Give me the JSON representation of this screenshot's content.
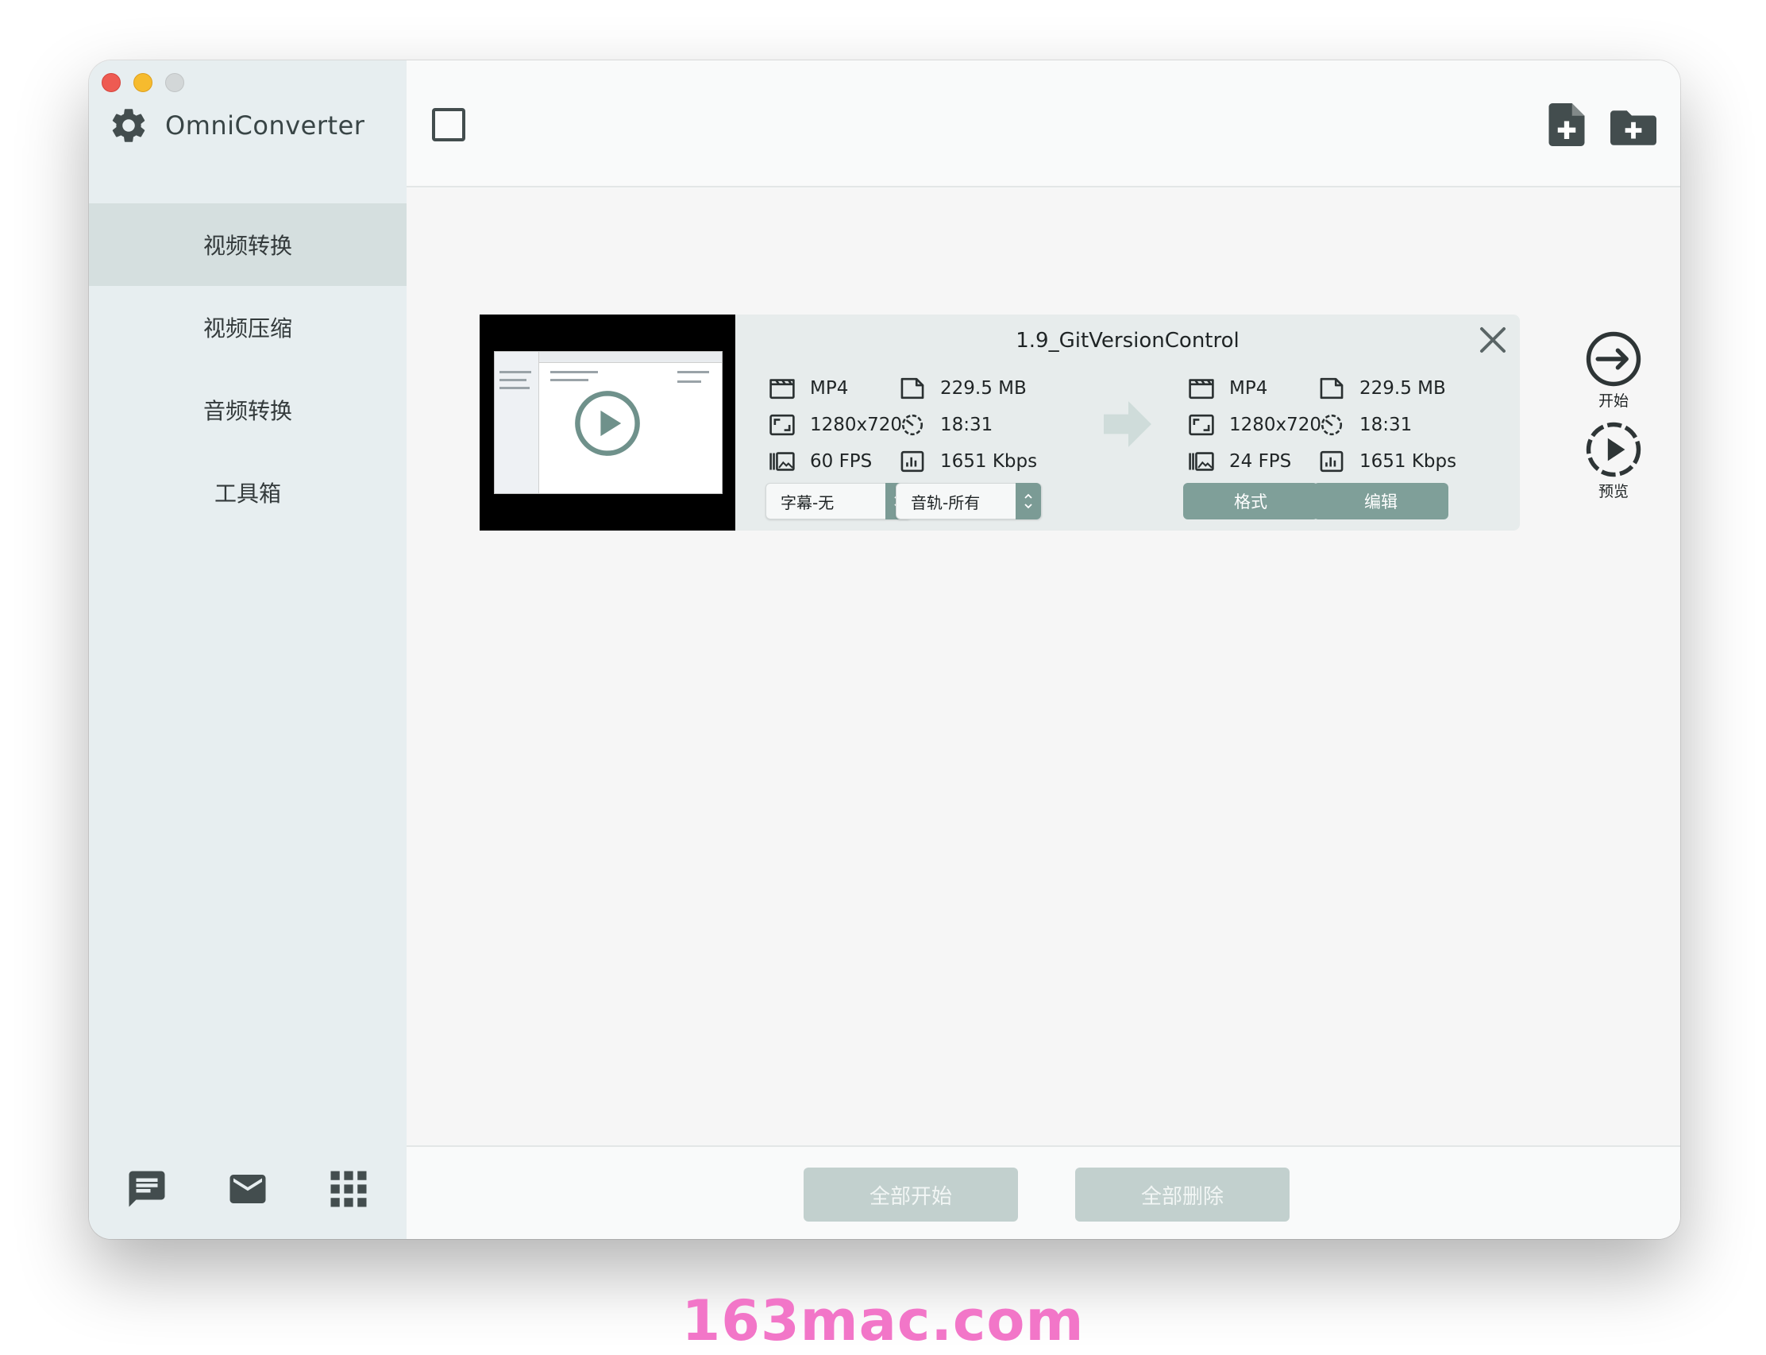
{
  "app": {
    "name": "OmniConverter"
  },
  "sidebar": {
    "items": [
      {
        "label": "视频转换",
        "active": true
      },
      {
        "label": "视频压缩",
        "active": false
      },
      {
        "label": "音频转换",
        "active": false
      },
      {
        "label": "工具箱",
        "active": false
      }
    ],
    "bottom_icons": [
      "chat-icon",
      "mail-icon",
      "grid-icon"
    ]
  },
  "toolbar": {
    "icons": [
      "select-all-checkbox",
      "add-file-icon",
      "add-folder-icon"
    ]
  },
  "task": {
    "title": "1.9_GitVersionControl",
    "source": {
      "format": "MP4",
      "resolution": "1280x720",
      "fps": "60 FPS",
      "size": "229.5 MB",
      "duration": "18:31",
      "bitrate": "1651 Kbps"
    },
    "output": {
      "format": "MP4",
      "resolution": "1280x720",
      "fps": "24 FPS",
      "size": "229.5 MB",
      "duration": "18:31",
      "bitrate": "1651 Kbps"
    },
    "subtitle_select": "字幕-无",
    "audio_select": "音轨-所有",
    "format_button": "格式",
    "edit_button": "编辑",
    "start_label": "开始",
    "preview_label": "预览"
  },
  "footer": {
    "start_all": "全部开始",
    "delete_all": "全部删除"
  },
  "colors": {
    "accent": "#7f9f99",
    "sidebar_bg": "#e7eef0",
    "icon_dark": "#434d4e",
    "watermark": "#f276c8"
  },
  "watermark": "163mac.com"
}
